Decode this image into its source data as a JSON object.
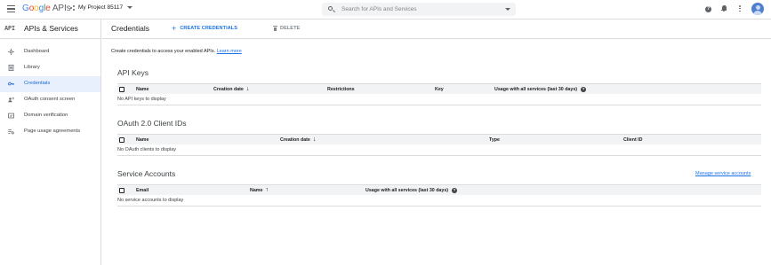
{
  "header": {
    "logo_google": [
      "G",
      "o",
      "o",
      "g",
      "l",
      "e"
    ],
    "logo_apis": "APIs",
    "project_name": "My Project 85117",
    "search_placeholder": "Search for APIs and Services",
    "help_glyph": "?"
  },
  "sidebar": {
    "api_badge": "API",
    "title": "APIs & Services",
    "items": [
      {
        "label": "Dashboard",
        "icon": "dashboard-icon",
        "active": false
      },
      {
        "label": "Library",
        "icon": "library-icon",
        "active": false
      },
      {
        "label": "Credentials",
        "icon": "key-icon",
        "active": true
      },
      {
        "label": "OAuth consent screen",
        "icon": "consent-icon",
        "active": false
      },
      {
        "label": "Domain verification",
        "icon": "domain-icon",
        "active": false
      },
      {
        "label": "Page usage agreements",
        "icon": "settings-list-icon",
        "active": false
      }
    ]
  },
  "main": {
    "title": "Credentials",
    "create_label": "CREATE CREDENTIALS",
    "delete_label": "DELETE",
    "intro_text": "Create credentials to access your enabled APIs.",
    "intro_link": "Learn more",
    "api_keys": {
      "title": "API Keys",
      "columns": [
        "Name",
        "Creation date",
        "Restrictions",
        "Key",
        "Usage with all services (last 30 days)"
      ],
      "empty": "No API keys to display"
    },
    "oauth": {
      "title": "OAuth 2.0 Client IDs",
      "columns": [
        "Name",
        "Creation date",
        "Type",
        "Client ID"
      ],
      "empty": "No OAuth clients to display"
    },
    "service_accounts": {
      "title": "Service Accounts",
      "manage_link": "Manage service accounts",
      "columns": [
        "Email",
        "Name",
        "Usage with all services (last 30 days)"
      ],
      "empty": "No service accounts to display"
    },
    "sort_down": "↓",
    "sort_up": "↑"
  },
  "colors": {
    "accent": "#1a73e8",
    "active_bg": "#e8f0fe",
    "header_bg": "#f1f3f4",
    "divider": "#dadce0"
  }
}
